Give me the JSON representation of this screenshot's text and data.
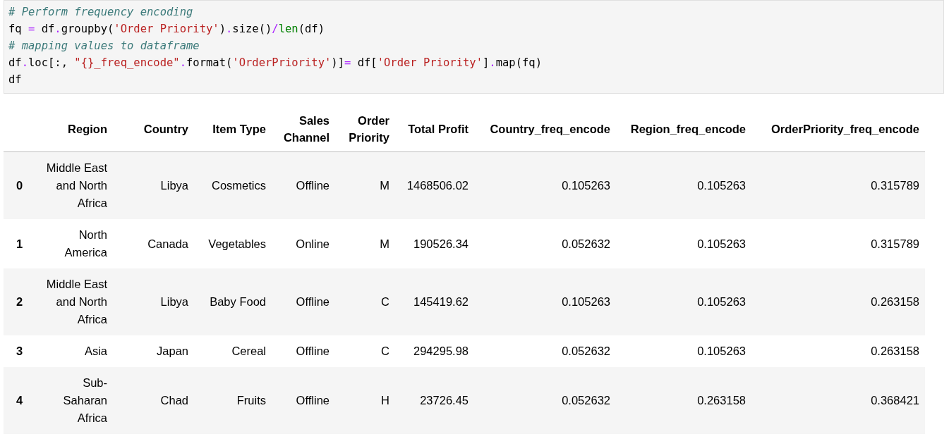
{
  "code_cell": {
    "lines": [
      [
        {
          "kind": "comment",
          "text": "# Perform frequency encoding"
        }
      ],
      [
        {
          "kind": "name",
          "text": "fq "
        },
        {
          "kind": "operator",
          "text": "="
        },
        {
          "kind": "name",
          "text": " df"
        },
        {
          "kind": "operator",
          "text": "."
        },
        {
          "kind": "name",
          "text": "groupby("
        },
        {
          "kind": "string",
          "text": "'Order Priority'"
        },
        {
          "kind": "name",
          "text": ")"
        },
        {
          "kind": "operator",
          "text": "."
        },
        {
          "kind": "name",
          "text": "size()"
        },
        {
          "kind": "operator",
          "text": "/"
        },
        {
          "kind": "builtin",
          "text": "len"
        },
        {
          "kind": "name",
          "text": "(df)"
        }
      ],
      [
        {
          "kind": "comment",
          "text": "# mapping values to dataframe"
        }
      ],
      [
        {
          "kind": "name",
          "text": "df"
        },
        {
          "kind": "operator",
          "text": "."
        },
        {
          "kind": "name",
          "text": "loc[:, "
        },
        {
          "kind": "string",
          "text": "\"{}_freq_encode\""
        },
        {
          "kind": "operator",
          "text": "."
        },
        {
          "kind": "name",
          "text": "format("
        },
        {
          "kind": "string",
          "text": "'OrderPriority'"
        },
        {
          "kind": "name",
          "text": ")]"
        },
        {
          "kind": "operator",
          "text": "="
        },
        {
          "kind": "name",
          "text": " df["
        },
        {
          "kind": "string",
          "text": "'Order Priority'"
        },
        {
          "kind": "name",
          "text": "]"
        },
        {
          "kind": "operator",
          "text": "."
        },
        {
          "kind": "name",
          "text": "map(fq)"
        }
      ],
      [
        {
          "kind": "name",
          "text": "df"
        }
      ]
    ]
  },
  "table": {
    "columns": [
      "",
      "Region",
      "Country",
      "Item Type",
      "Sales Channel",
      "Order Priority",
      "Total Profit",
      "Country_freq_encode",
      "Region_freq_encode",
      "OrderPriority_freq_encode"
    ],
    "rows": [
      [
        "0",
        "Middle East and North Africa",
        "Libya",
        "Cosmetics",
        "Offline",
        "M",
        "1468506.02",
        "0.105263",
        "0.105263",
        "0.315789"
      ],
      [
        "1",
        "North America",
        "Canada",
        "Vegetables",
        "Online",
        "M",
        "190526.34",
        "0.052632",
        "0.105263",
        "0.315789"
      ],
      [
        "2",
        "Middle East and North Africa",
        "Libya",
        "Baby Food",
        "Offline",
        "C",
        "145419.62",
        "0.105263",
        "0.105263",
        "0.263158"
      ],
      [
        "3",
        "Asia",
        "Japan",
        "Cereal",
        "Offline",
        "C",
        "294295.98",
        "0.052632",
        "0.105263",
        "0.263158"
      ],
      [
        "4",
        "Sub-Saharan Africa",
        "Chad",
        "Fruits",
        "Offline",
        "H",
        "23726.45",
        "0.052632",
        "0.263158",
        "0.368421"
      ]
    ]
  }
}
